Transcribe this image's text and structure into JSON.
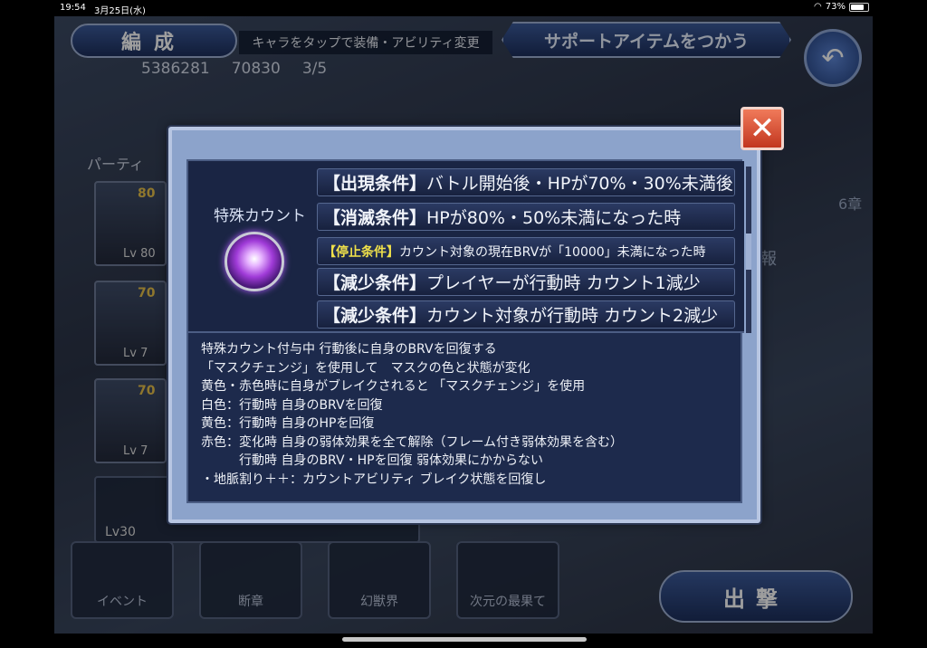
{
  "status_bar": {
    "time": "19:54",
    "date": "3月25日(水)",
    "battery": "73%"
  },
  "header": {
    "title": "編成",
    "subtitle": "キャラをタップで装備・アビリティ変更",
    "support_button": "サポートアイテムをつかう",
    "back_icon": "back-arrow-icon"
  },
  "resources": {
    "gil": "5386281",
    "gems": "70830",
    "count": "3/5"
  },
  "party": {
    "label": "パーティ",
    "slots": [
      {
        "level_text": "Lv 80",
        "num": "80"
      },
      {
        "level_text": "Lv 7",
        "num": "70"
      },
      {
        "level_text": "Lv 7",
        "num": "70"
      }
    ],
    "extra_level": "Lv30"
  },
  "side": {
    "chapter": "6章",
    "info": "報"
  },
  "bottom_tabs": [
    "イベント",
    "断章",
    "幻獣界",
    "次元の最果て"
  ],
  "sortie_button": "出撃",
  "modal": {
    "count_title": "特殊カウント",
    "conditions": [
      {
        "tag": "【出現条件】",
        "text": "バトル開始後・HPが70%・30%未満後",
        "highlight": false,
        "size": "big"
      },
      {
        "tag": "【消滅条件】",
        "text": "HPが80%・50%未満になった時",
        "highlight": false,
        "size": "big"
      },
      {
        "tag": "【停止条件】",
        "text": "カウント対象の現在BRVが「10000」未満になった時",
        "highlight": true,
        "size": "small"
      },
      {
        "tag": "【減少条件】",
        "text": "プレイヤーが行動時 カウント1減少",
        "highlight": false,
        "size": "big"
      },
      {
        "tag": "【減少条件】",
        "text": "カウント対象が行動時 カウント2減少",
        "highlight": false,
        "size": "big"
      }
    ],
    "description_lines": [
      "特殊カウント付与中 行動後に自身のBRVを回復する",
      "",
      "「マスクチェンジ」を使用して　マスクの色と状態が変化",
      "黄色・赤色時に自身がブレイクされると 「マスクチェンジ」を使用",
      "白色：行動時 自身のBRVを回復",
      "黄色：行動時 自身のHPを回復",
      "赤色：変化時 自身の弱体効果を全て解除（フレーム付き弱体効果を含む）",
      "　　　行動時 自身のBRV・HPを回復 弱体効果にかからない",
      "・地脈割り＋＋：カウントアビリティ ブレイク状態を回復し"
    ],
    "close_icon": "close-icon"
  }
}
